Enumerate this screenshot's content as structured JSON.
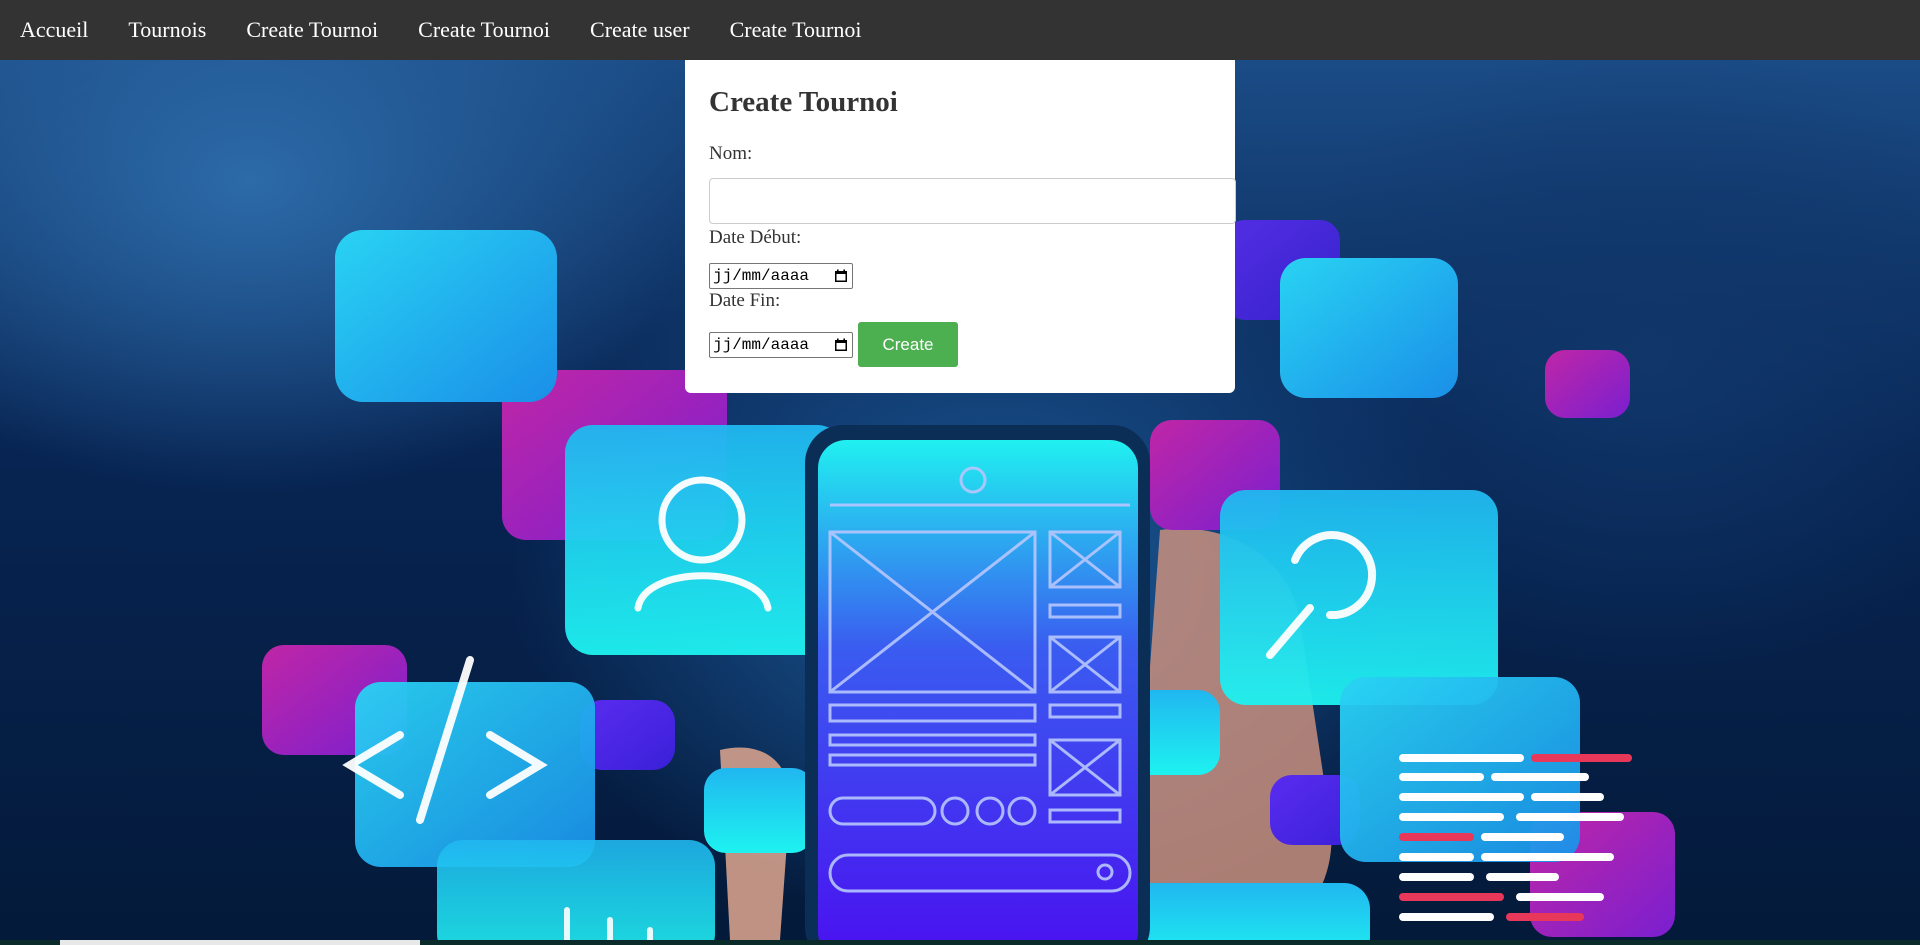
{
  "nav": {
    "items": [
      {
        "label": "Accueil"
      },
      {
        "label": "Tournois"
      },
      {
        "label": "Create Tournoi"
      },
      {
        "label": "Create Tournoi"
      },
      {
        "label": "Create user"
      },
      {
        "label": "Create Tournoi"
      }
    ]
  },
  "form": {
    "title": "Create Tournoi",
    "nom_label": "Nom:",
    "nom_value": "",
    "debut_label": "Date Début:",
    "debut_placeholder": "jj/mm/aaaa",
    "fin_label": "Date Fin:",
    "fin_placeholder": "jj/mm/aaaa",
    "submit_label": "Create"
  },
  "colors": {
    "navbar": "#333333",
    "button": "#4caf50",
    "card": "#ffffff"
  },
  "icons": {
    "date_picker": "calendar-icon"
  }
}
